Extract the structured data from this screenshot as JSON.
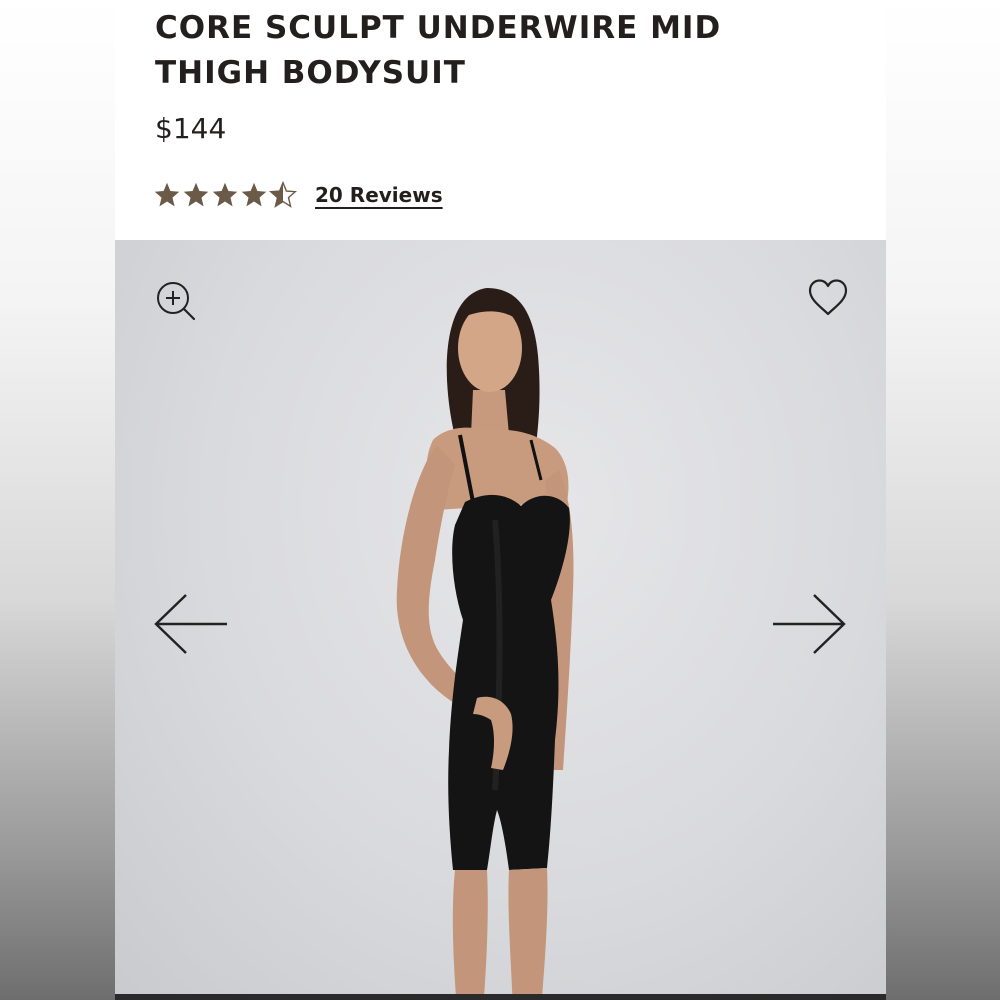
{
  "product": {
    "title": "CORE SCULPT UNDERWIRE MID THIGH BODYSUIT",
    "price": "$144",
    "rating": 4.5,
    "rating_max": 5,
    "reviews_label": "20 Reviews"
  },
  "colors": {
    "star": "#6b5a48",
    "text": "#231f1e",
    "gallery_bg": "#d9dadd"
  },
  "gallery": {
    "zoom_icon": "zoom-in-icon",
    "favorite_icon": "heart-icon",
    "prev_icon": "arrow-left-icon",
    "next_icon": "arrow-right-icon"
  }
}
